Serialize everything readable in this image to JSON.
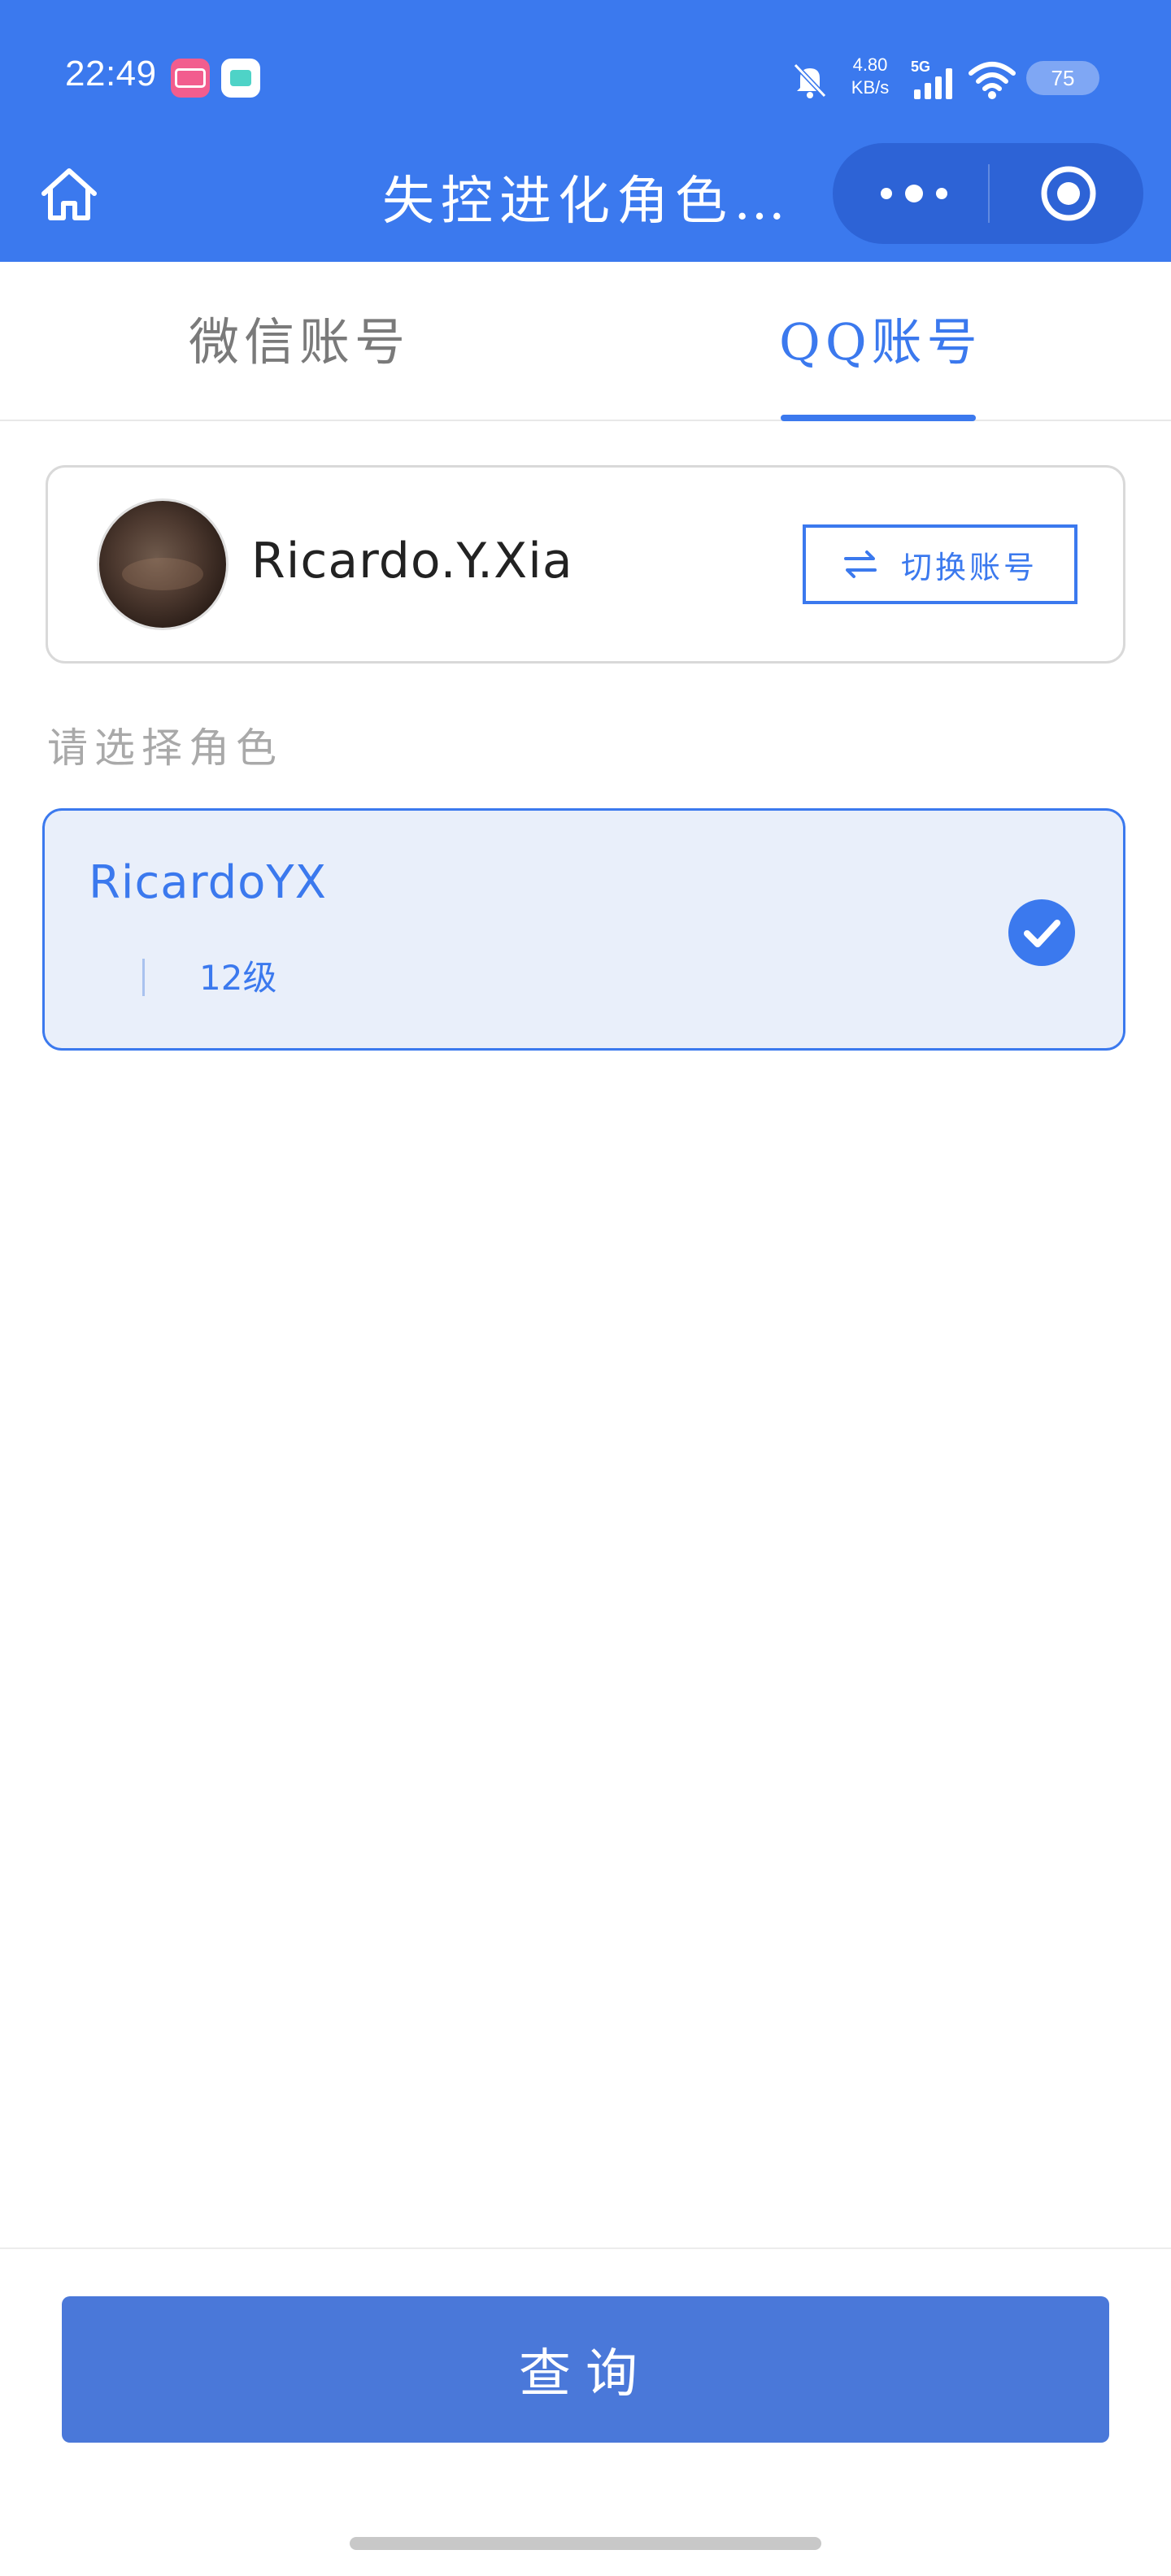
{
  "status_bar": {
    "time": "22:49",
    "net_speed_value": "4.80",
    "net_speed_unit": "KB/s",
    "network": "5G",
    "battery": "75",
    "icons": [
      "bilibili-app-icon",
      "mini-app-icon",
      "bell-off-icon",
      "signal-icon",
      "wifi-icon"
    ]
  },
  "nav": {
    "title": "失控进化角色…",
    "icons": [
      "home-icon",
      "more-icon",
      "close-target-icon"
    ]
  },
  "tabs": [
    {
      "label": "微信账号",
      "active": false
    },
    {
      "label": "QQ账号",
      "active": true
    }
  ],
  "account": {
    "name": "Ricardo.Y.Xia",
    "switch_label": "切换账号",
    "switch_icon": "swap-arrows-icon"
  },
  "roles": {
    "section_label": "请选择角色",
    "items": [
      {
        "name": "RicardoYX",
        "level": "12级",
        "selected": true
      }
    ]
  },
  "footer": {
    "query_label": "查询"
  },
  "colors": {
    "primary": "#3b79ee",
    "button": "#4a78d9",
    "selected_bg": "#e9effa",
    "muted_text": "#a9a9a9"
  }
}
